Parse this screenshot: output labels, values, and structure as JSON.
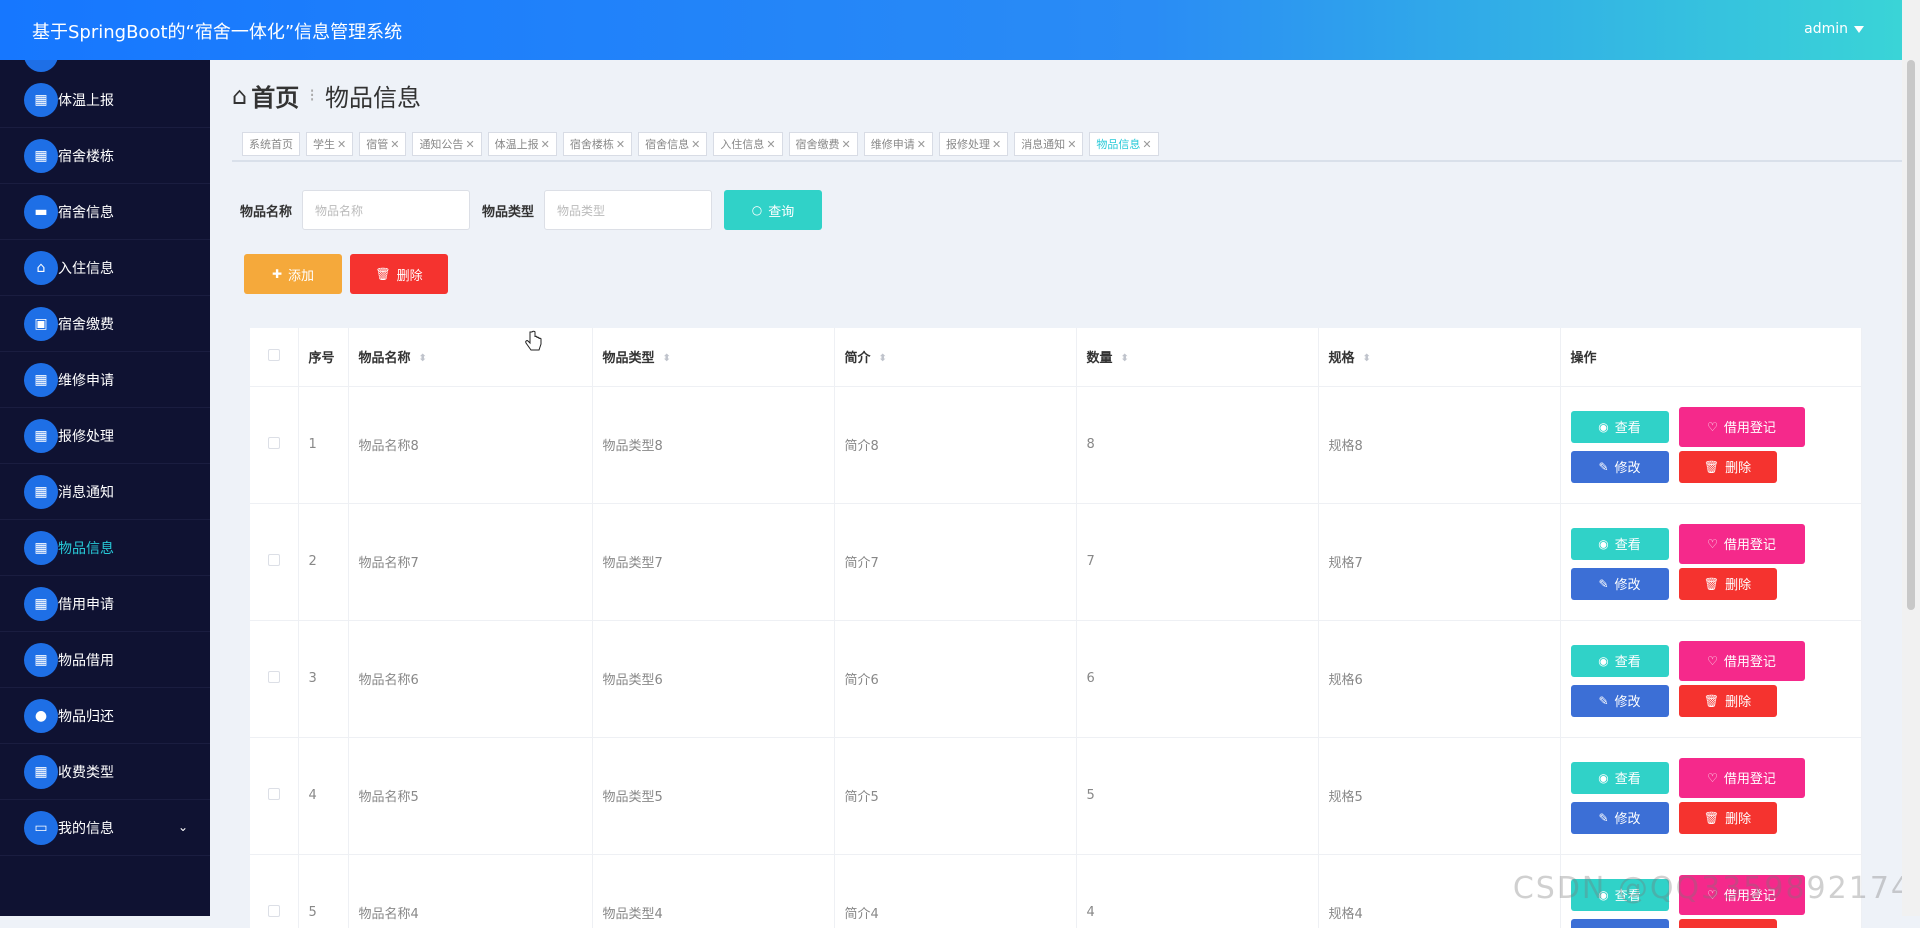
{
  "header": {
    "title": "基于SpringBoot的“宿舍一体化”信息管理系统",
    "user": "admin"
  },
  "sidebar": {
    "items": [
      {
        "label": "体温上报",
        "icon": "grid-icon"
      },
      {
        "label": "宿舍楼栋",
        "icon": "grid-icon"
      },
      {
        "label": "宿舍信息",
        "icon": "bed-icon"
      },
      {
        "label": "入住信息",
        "icon": "checkin-icon"
      },
      {
        "label": "宿舍缴费",
        "icon": "clipboard-icon"
      },
      {
        "label": "维修申请",
        "icon": "grid-icon"
      },
      {
        "label": "报修处理",
        "icon": "grid-icon"
      },
      {
        "label": "消息通知",
        "icon": "grid-icon"
      },
      {
        "label": "物品信息",
        "icon": "grid-icon",
        "active": true
      },
      {
        "label": "借用申请",
        "icon": "grid-icon"
      },
      {
        "label": "物品借用",
        "icon": "grid-icon"
      },
      {
        "label": "物品归还",
        "icon": "user-icon"
      },
      {
        "label": "收费类型",
        "icon": "grid-icon"
      },
      {
        "label": "我的信息",
        "icon": "wallet-icon",
        "expandable": true
      }
    ]
  },
  "breadcrumb": {
    "home": "首页",
    "current": "物品信息"
  },
  "tabs": [
    {
      "label": "系统首页",
      "closable": false
    },
    {
      "label": "学生",
      "closable": true
    },
    {
      "label": "宿管",
      "closable": true
    },
    {
      "label": "通知公告",
      "closable": true
    },
    {
      "label": "体温上报",
      "closable": true
    },
    {
      "label": "宿舍楼栋",
      "closable": true
    },
    {
      "label": "宿舍信息",
      "closable": true
    },
    {
      "label": "入住信息",
      "closable": true
    },
    {
      "label": "宿舍缴费",
      "closable": true
    },
    {
      "label": "维修申请",
      "closable": true
    },
    {
      "label": "报修处理",
      "closable": true
    },
    {
      "label": "消息通知",
      "closable": true
    },
    {
      "label": "物品信息",
      "closable": true,
      "active": true
    }
  ],
  "search": {
    "name_label": "物品名称",
    "name_placeholder": "物品名称",
    "type_label": "物品类型",
    "type_placeholder": "物品类型",
    "query_label": "查询"
  },
  "actions": {
    "add_label": "添加",
    "delete_label": "删除"
  },
  "table": {
    "headers": {
      "index": "序号",
      "name": "物品名称",
      "type": "物品类型",
      "intro": "简介",
      "qty": "数量",
      "spec": "规格",
      "op": "操作"
    },
    "row_buttons": {
      "view": "查看",
      "register": "借用登记",
      "edit": "修改",
      "remove": "删除"
    },
    "rows": [
      {
        "index": "1",
        "name": "物品名称8",
        "type": "物品类型8",
        "intro": "简介8",
        "qty": "8",
        "spec": "规格8"
      },
      {
        "index": "2",
        "name": "物品名称7",
        "type": "物品类型7",
        "intro": "简介7",
        "qty": "7",
        "spec": "规格7"
      },
      {
        "index": "3",
        "name": "物品名称6",
        "type": "物品类型6",
        "intro": "简介6",
        "qty": "6",
        "spec": "规格6"
      },
      {
        "index": "4",
        "name": "物品名称5",
        "type": "物品类型5",
        "intro": "简介5",
        "qty": "5",
        "spec": "规格5"
      },
      {
        "index": "5",
        "name": "物品名称4",
        "type": "物品类型4",
        "intro": "简介4",
        "qty": "4",
        "spec": "规格4"
      }
    ]
  },
  "watermark": "CSDN @QQ3359892174",
  "colors": {
    "header_start": "#1677ff",
    "header_end": "#3ad6d6",
    "sidebar_bg": "#0f1232",
    "accent": "#27c9d8"
  }
}
